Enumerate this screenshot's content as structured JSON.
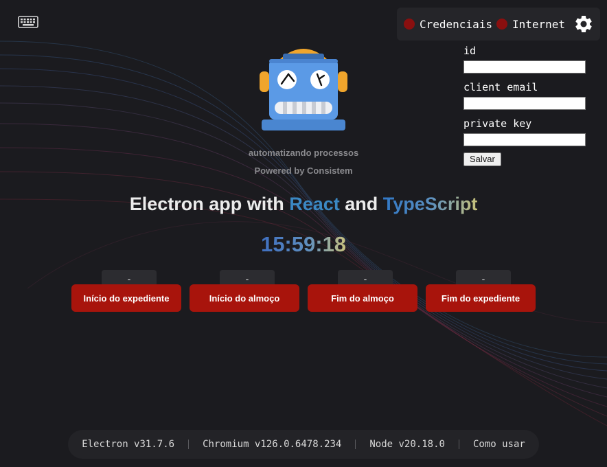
{
  "colors": {
    "background": "#1b1b1f",
    "status_off": "#8a0f0f",
    "action_button": "#a8140c",
    "react": "#3b88c3",
    "typescript": "#3178c6"
  },
  "toolbar": {
    "keyboard_icon": "keyboard-icon"
  },
  "status": {
    "credentials_label": "Credenciais",
    "internet_label": "Internet",
    "settings_icon": "gear-icon"
  },
  "credentials_form": {
    "id_label": "id",
    "id_value": "",
    "client_email_label": "client email",
    "client_email_value": "",
    "private_key_label": "private key",
    "private_key_value": "",
    "save_label": "Salvar"
  },
  "brand": {
    "tagline": "automatizando processos",
    "powered_by": "Powered by Consistem"
  },
  "headline": {
    "prefix": "Electron app with ",
    "react": "React",
    "and": " and ",
    "typescript": "TypeScript"
  },
  "clock": "15:59:18",
  "actions": [
    {
      "time": "-",
      "label": "Início do expediente"
    },
    {
      "time": "-",
      "label": "Início do almoço"
    },
    {
      "time": "-",
      "label": "Fim do almoço"
    },
    {
      "time": "-",
      "label": "Fim do expediente"
    }
  ],
  "versions": {
    "electron": "Electron v31.7.6",
    "chromium": "Chromium v126.0.6478.234",
    "node": "Node v20.18.0",
    "how_to": "Como usar"
  }
}
